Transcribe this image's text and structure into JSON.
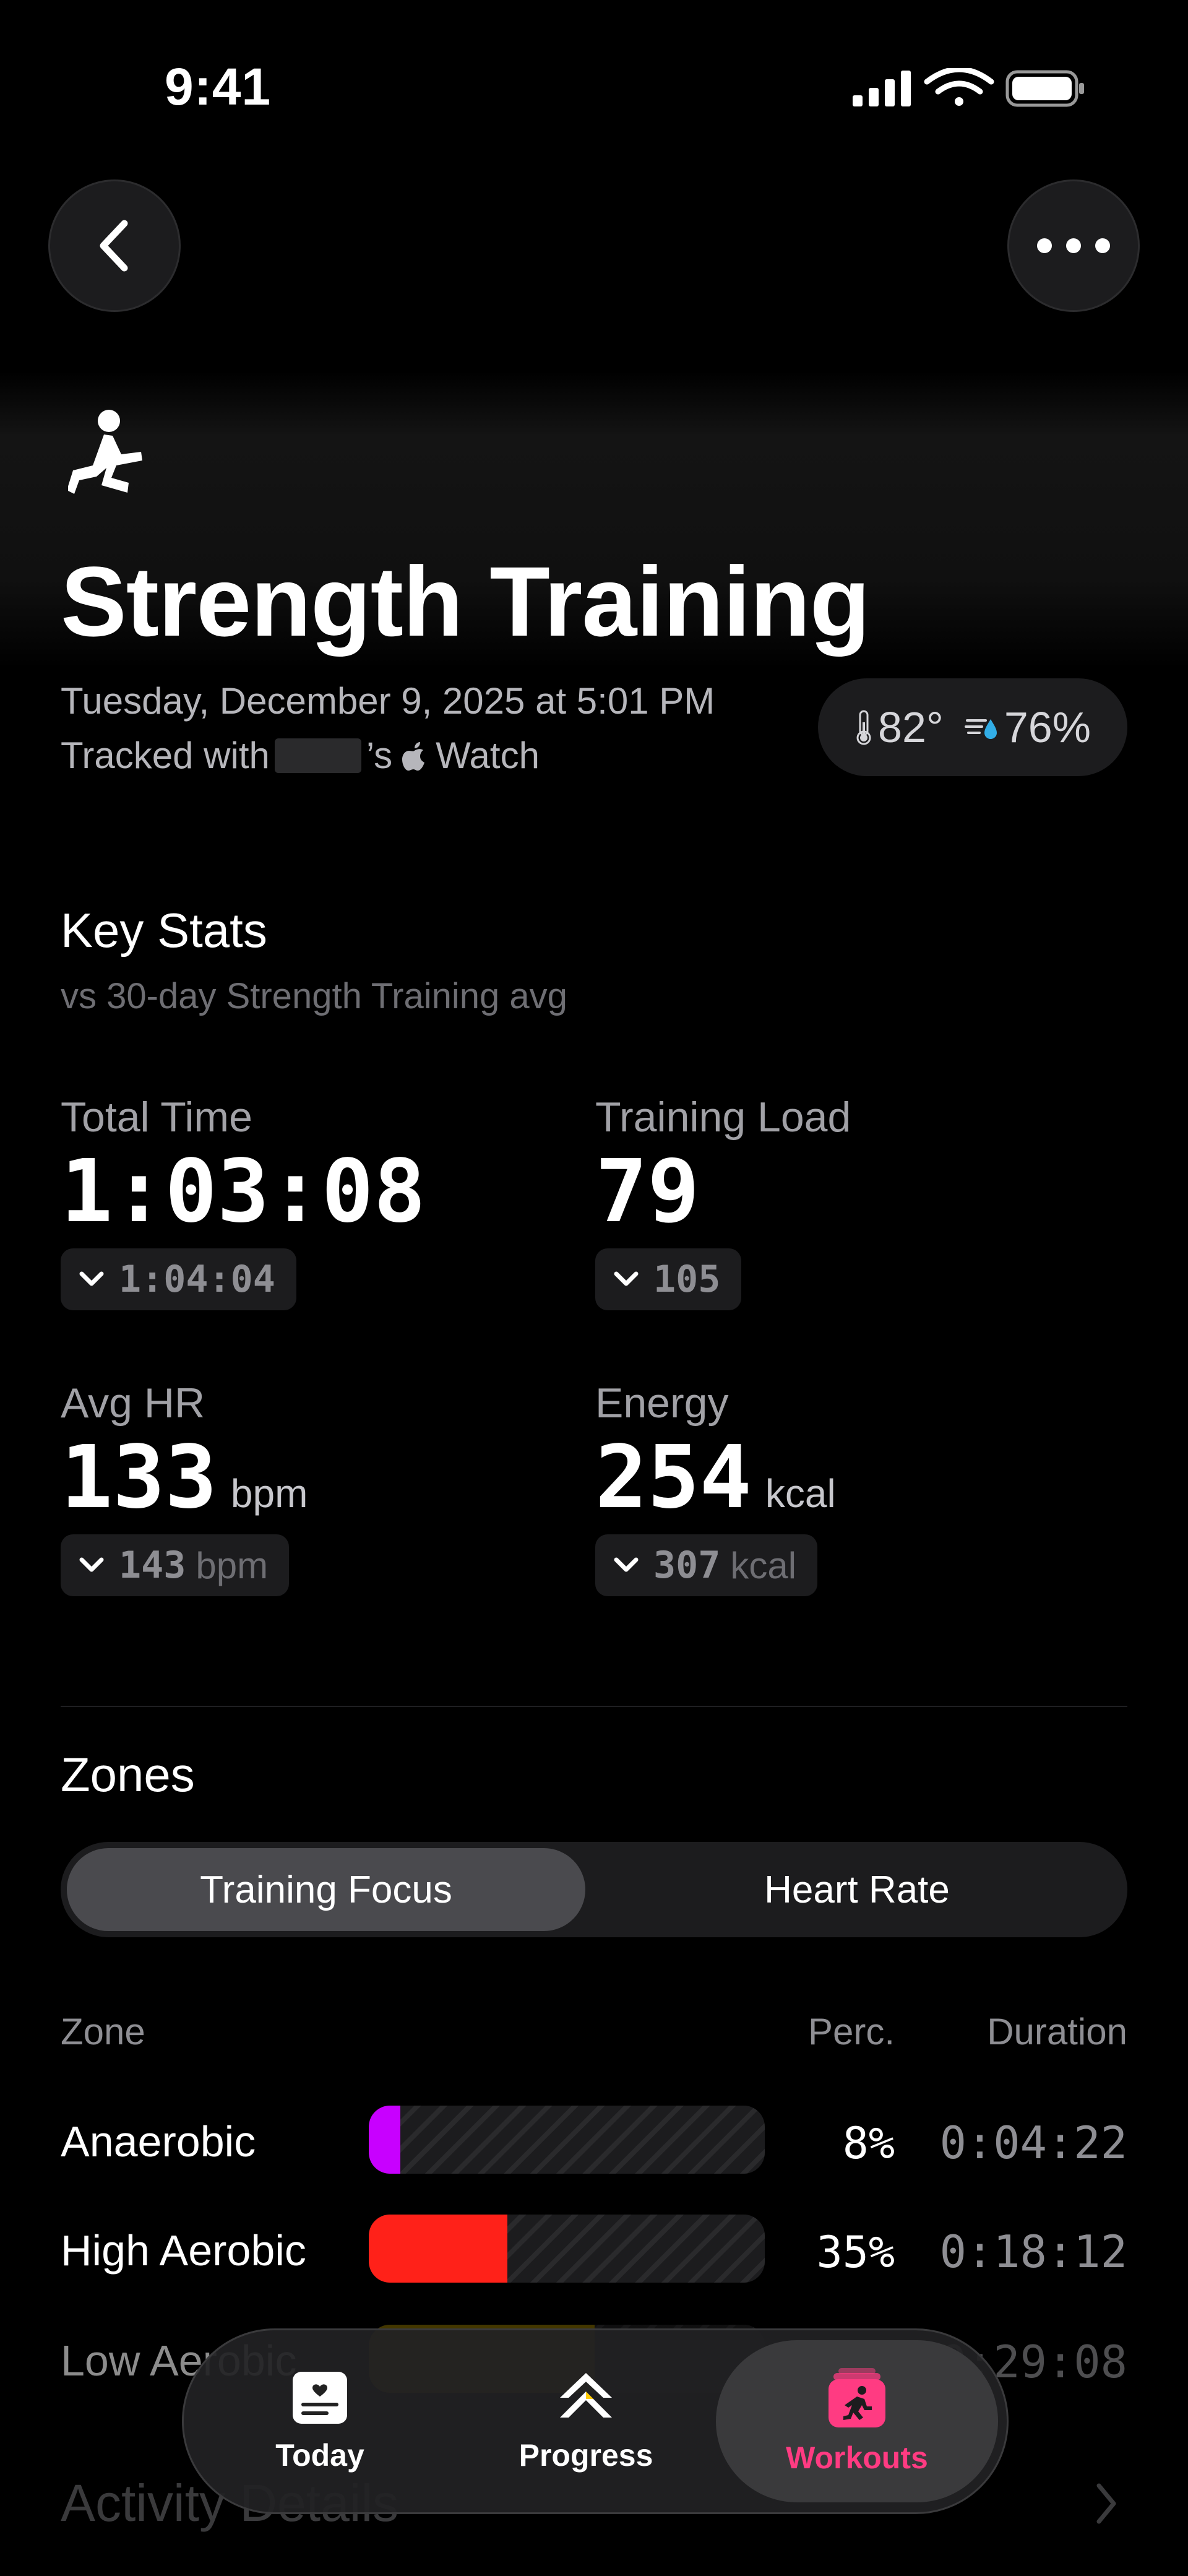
{
  "status_bar": {
    "time": "9:41"
  },
  "header": {
    "title": "Strength Training",
    "date": "Tuesday, December 9, 2025 at 5:01 PM",
    "tracked_prefix": "Tracked with",
    "tracked_suffix": "’s",
    "device": "Watch",
    "weather": {
      "temperature": "82°",
      "humidity": "76%"
    }
  },
  "key_stats": {
    "title": "Key Stats",
    "subtitle": "vs 30-day Strength Training avg",
    "stats": [
      {
        "label": "Total Time",
        "value": "1:03:08",
        "unit": "",
        "avg": "1:04:04",
        "avg_unit": ""
      },
      {
        "label": "Training Load",
        "value": "79",
        "unit": "",
        "avg": "105",
        "avg_unit": ""
      },
      {
        "label": "Avg HR",
        "value": "133",
        "unit": "bpm",
        "avg": "143",
        "avg_unit": "bpm"
      },
      {
        "label": "Energy",
        "value": "254",
        "unit": "kcal",
        "avg": "307",
        "avg_unit": "kcal"
      }
    ]
  },
  "zones": {
    "title": "Zones",
    "segments": [
      "Training Focus",
      "Heart Rate"
    ],
    "selected_segment": "Training Focus",
    "columns": {
      "zone": "Zone",
      "percent": "Perc.",
      "duration": "Duration"
    },
    "rows": [
      {
        "name": "Anaerobic",
        "percent": "8%",
        "fraction": 0.08,
        "duration": "0:04:22",
        "color": "#c800ff"
      },
      {
        "name": "High Aerobic",
        "percent": "35%",
        "fraction": 0.35,
        "duration": "0:18:12",
        "color": "#ff2119"
      },
      {
        "name": "Low Aerobic",
        "percent": "",
        "fraction": 0.57,
        "duration": "0:29:08",
        "color": "#7a6400"
      }
    ]
  },
  "activity_details": {
    "title": "Activity Details"
  },
  "tab_bar": {
    "items": [
      {
        "label": "Today",
        "icon": "today-icon"
      },
      {
        "label": "Progress",
        "icon": "progress-icon"
      },
      {
        "label": "Workouts",
        "icon": "workouts-icon"
      }
    ],
    "selected": "Workouts",
    "accent_color": "#ff3b82"
  }
}
